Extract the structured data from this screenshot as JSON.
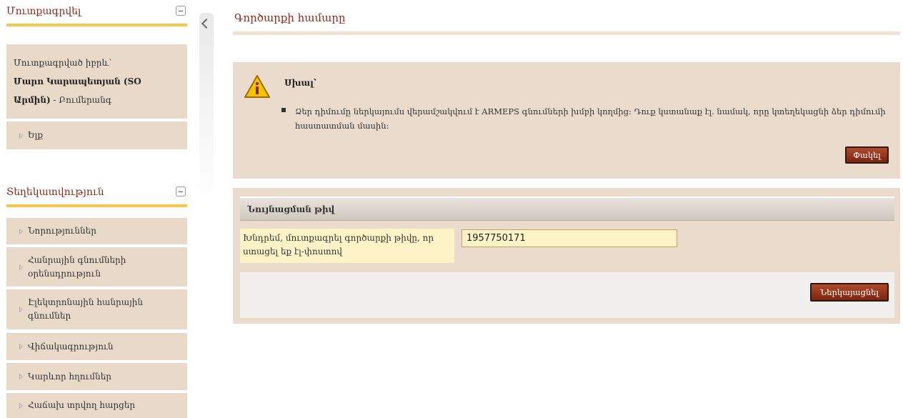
{
  "sidebar": {
    "login_panel": {
      "title": "Մուտքագրվել",
      "logged_in_as_label": "Մուտքագրված իբրև՝",
      "user_name": "Մարո Կարապետյան (SO Արմին)",
      "user_role": "- Բումերանգ",
      "exit_label": "Ելք"
    },
    "info_panel": {
      "title": "Տեղեկատվություն",
      "items": [
        {
          "label": "Նորություններ"
        },
        {
          "label": "Հանրային գնումների օրենսդրություն"
        },
        {
          "label": "Էլեկտրոնային հանրային գնումներ"
        },
        {
          "label": "Վիճակագրություն"
        },
        {
          "label": "Կարևոր հղումներ"
        },
        {
          "label": "Հաճախ տրվող հարցեր"
        }
      ]
    }
  },
  "main": {
    "page_title": "Գործարքի համարը",
    "error": {
      "label": "Սխալ՝",
      "message": "Ձեր դիմումը ներկայումս վերամշակվում է ARMEPS գնումների խմբի կողմից: Դուք կստանաք էլ. նամակ, որը կտեղեկացնի ձեր դիմումի հաստատման մասին:",
      "close_label": "Փակել"
    },
    "form": {
      "header": "Նույնացման թիվ",
      "field_label": "Խնդրեմ, մուտքագրել գործարքի թիվը, որ ստացել եք էլ-փոստով",
      "field_value": "1957750171",
      "submit_label": "Ներկայացնել"
    }
  },
  "colors": {
    "accent_title": "#8a2b18",
    "panel_bg": "#eadbcc",
    "underline": "#f7c64a",
    "button": "#9a3a1f"
  }
}
